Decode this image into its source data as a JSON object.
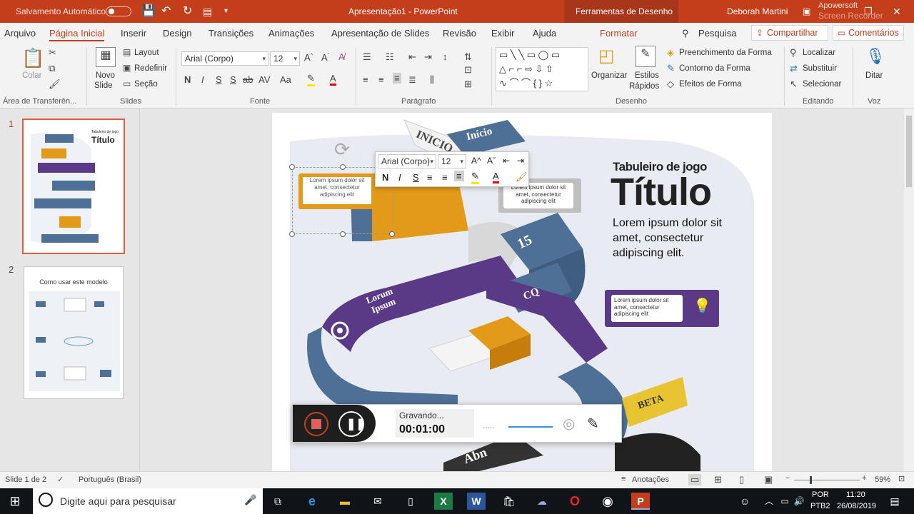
{
  "titlebar": {
    "autosave_label": "Salvamento Automático",
    "doc_title": "Apresentação1  -  PowerPoint",
    "context_tab": "Ferramentas de Desenho",
    "user": "Deborah Martini",
    "overlay_brand": "Apowersoft",
    "overlay_brand2": "Screen Recorder"
  },
  "tabs": [
    "Arquivo",
    "Página Inicial",
    "Inserir",
    "Design",
    "Transições",
    "Animações",
    "Apresentação de Slides",
    "Revisão",
    "Exibir",
    "Ajuda",
    "Formatar"
  ],
  "search_label": "Pesquisa",
  "share_label": "Compartilhar",
  "comments_label": "Comentários",
  "ribbon": {
    "clipboard": {
      "paste": "Colar",
      "group": "Área de Transferên..."
    },
    "slides": {
      "new_slide_1": "Novo",
      "new_slide_2": "Slide",
      "layout": "Layout",
      "reset": "Redefinir",
      "section": "Seção",
      "group": "Slides"
    },
    "font": {
      "font_name": "Arial (Corpo)",
      "font_size": "12",
      "group": "Fonte"
    },
    "paragraph": {
      "group": "Parágrafo"
    },
    "drawing": {
      "arrange": "Organizar",
      "quick_styles_1": "Estilos",
      "quick_styles_2": "Rápidos",
      "fill": "Preenchimento da Forma",
      "outline": "Contorno da Forma",
      "effects": "Efeitos de Forma",
      "group": "Desenho"
    },
    "editing": {
      "find": "Localizar",
      "replace": "Substituir",
      "select": "Selecionar",
      "group": "Editando"
    },
    "voice": {
      "dictate": "Ditar",
      "group": "Voz"
    }
  },
  "thumb2_title": "Como usar este modelo",
  "slide": {
    "subtitle": "Tabuleiro de jogo",
    "title": "Título",
    "body": "Lorem ipsum dolor sit amet, consectetur adipiscing elit.",
    "callout_selected": "Lorem ipsum dolor sit amet, consectetur adipiscing elit",
    "callout_top": "Lorem ipsum dolor sit amet, consectetur adipiscing elit",
    "callout_purple": "Lorem ipsum dolor sit amet, consectetur adipiscing elit",
    "start_flag": "INICIO",
    "start_tile": "Início",
    "tile_15": "15",
    "tile_cq": "CQ",
    "lorum_ipsum": "Lorum Ipsum",
    "beta": "BETA",
    "abn": "Abn"
  },
  "floatbar": {
    "font_name": "Arial (Corpo)",
    "font_size": "12",
    "bold": "N",
    "italic": "I",
    "underline": "S"
  },
  "recorder": {
    "status": "Gravando...",
    "time": "00:01:00"
  },
  "status": {
    "slide_count": "Slide 1 de 2",
    "language": "Português (Brasil)",
    "notes": "Anotações",
    "zoom": "59%"
  },
  "taskbar": {
    "search_placeholder": "Digite aqui para pesquisar",
    "lang": "POR",
    "layout": "PTB2",
    "time": "11:20",
    "date": "26/08/2019"
  },
  "colors": {
    "accent": "#c43e1c",
    "board_blue": "#4e6f96",
    "board_purple": "#5a3a86",
    "board_orange": "#e39a19"
  }
}
